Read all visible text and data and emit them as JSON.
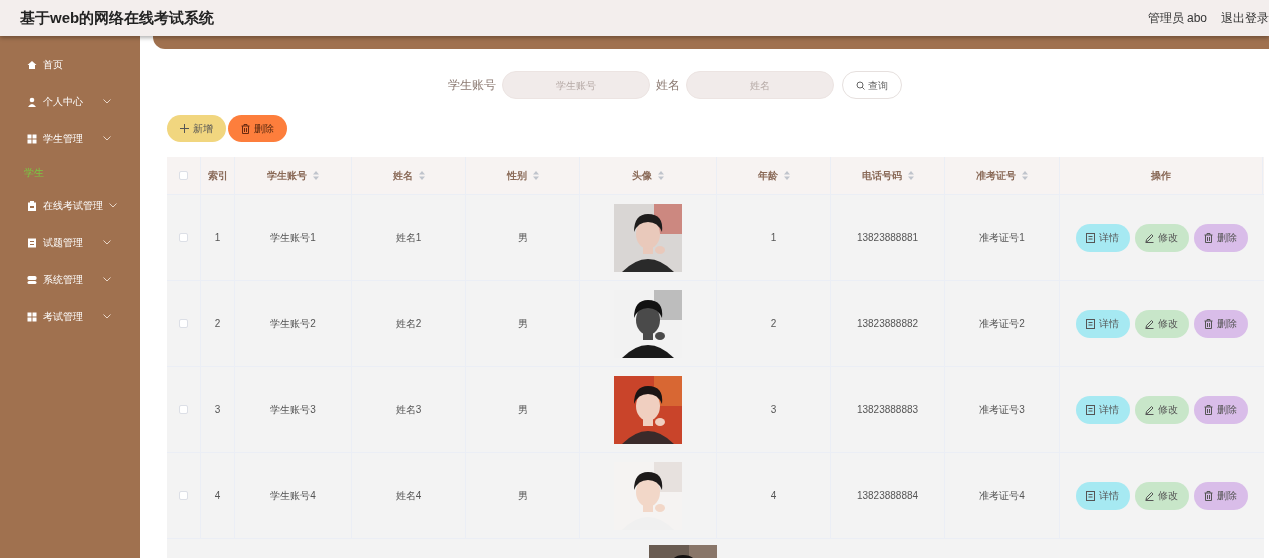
{
  "header": {
    "title": "基于web的网络在线考试系统",
    "user": "管理员 abo",
    "logout": "退出登录"
  },
  "sidebar": {
    "items": [
      {
        "label": "首页"
      },
      {
        "label": "个人中心"
      },
      {
        "label": "学生管理",
        "children": [
          {
            "label": "学生",
            "selected": true
          }
        ]
      },
      {
        "label": "在线考试管理"
      },
      {
        "label": "试题管理"
      },
      {
        "label": "系统管理"
      },
      {
        "label": "考试管理"
      }
    ]
  },
  "search": {
    "fields": [
      {
        "label": "学生账号",
        "placeholder": "学生账号"
      },
      {
        "label": "姓名",
        "placeholder": "姓名"
      }
    ],
    "button": "查询"
  },
  "actions": [
    {
      "label": "新增",
      "kind": "add"
    },
    {
      "label": "删除",
      "kind": "delete"
    }
  ],
  "table": {
    "all_checked": false,
    "columns": [
      "索引",
      "学生账号",
      "姓名",
      "性别",
      "头像",
      "年龄",
      "电话号码",
      "准考证号",
      "操作"
    ],
    "rows": [
      {
        "kind": "full",
        "checked": false,
        "index": "1",
        "account": "学生账号1",
        "name": "姓名1",
        "gender": "男",
        "age": "1",
        "phone": "13823888881",
        "ticket": "准考证号1",
        "buttons": [
          {
            "label": "详情",
            "kind": "detail"
          },
          {
            "label": "修改",
            "kind": "edit"
          },
          {
            "label": "删除",
            "kind": "delete"
          }
        ]
      },
      {
        "kind": "full",
        "checked": false,
        "index": "2",
        "account": "学生账号2",
        "name": "姓名2",
        "gender": "男",
        "age": "2",
        "phone": "13823888882",
        "ticket": "准考证号2",
        "buttons": [
          {
            "label": "详情",
            "kind": "detail"
          },
          {
            "label": "修改",
            "kind": "edit"
          },
          {
            "label": "删除",
            "kind": "delete"
          }
        ]
      },
      {
        "kind": "full",
        "checked": false,
        "index": "3",
        "account": "学生账号3",
        "name": "姓名3",
        "gender": "男",
        "age": "3",
        "phone": "13823888883",
        "ticket": "准考证号3",
        "buttons": [
          {
            "label": "详情",
            "kind": "detail"
          },
          {
            "label": "修改",
            "kind": "edit"
          },
          {
            "label": "删除",
            "kind": "delete"
          }
        ]
      },
      {
        "kind": "full",
        "checked": false,
        "index": "4",
        "account": "学生账号4",
        "name": "姓名4",
        "gender": "男",
        "age": "4",
        "phone": "13823888884",
        "ticket": "准考证号4",
        "buttons": [
          {
            "label": "详情",
            "kind": "detail"
          },
          {
            "label": "修改",
            "kind": "edit"
          },
          {
            "label": "删除",
            "kind": "delete"
          }
        ]
      },
      {
        "kind": "partial"
      }
    ]
  }
}
